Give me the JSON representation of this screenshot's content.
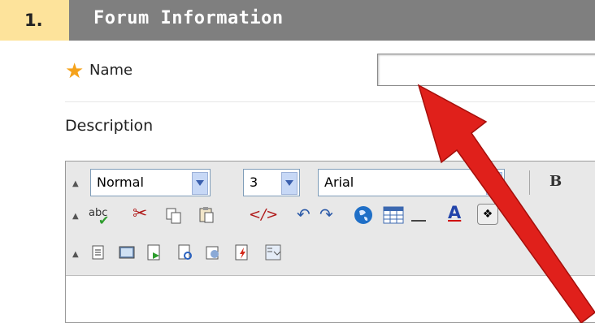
{
  "section": {
    "number": "1.",
    "title": "Forum Information"
  },
  "name_field": {
    "label": "Name",
    "value": ""
  },
  "description_label": "Description",
  "toolbar": {
    "format_value": "Normal",
    "size_value": "3",
    "font_value": "Arial",
    "bold_label": "B",
    "spell_label": "abc",
    "text_color_label": "A"
  },
  "colors": {
    "header_bg": "#7f7f7f",
    "step_bg": "#fde39b",
    "required": "#f5a21b",
    "annotation": "#e0201b"
  }
}
